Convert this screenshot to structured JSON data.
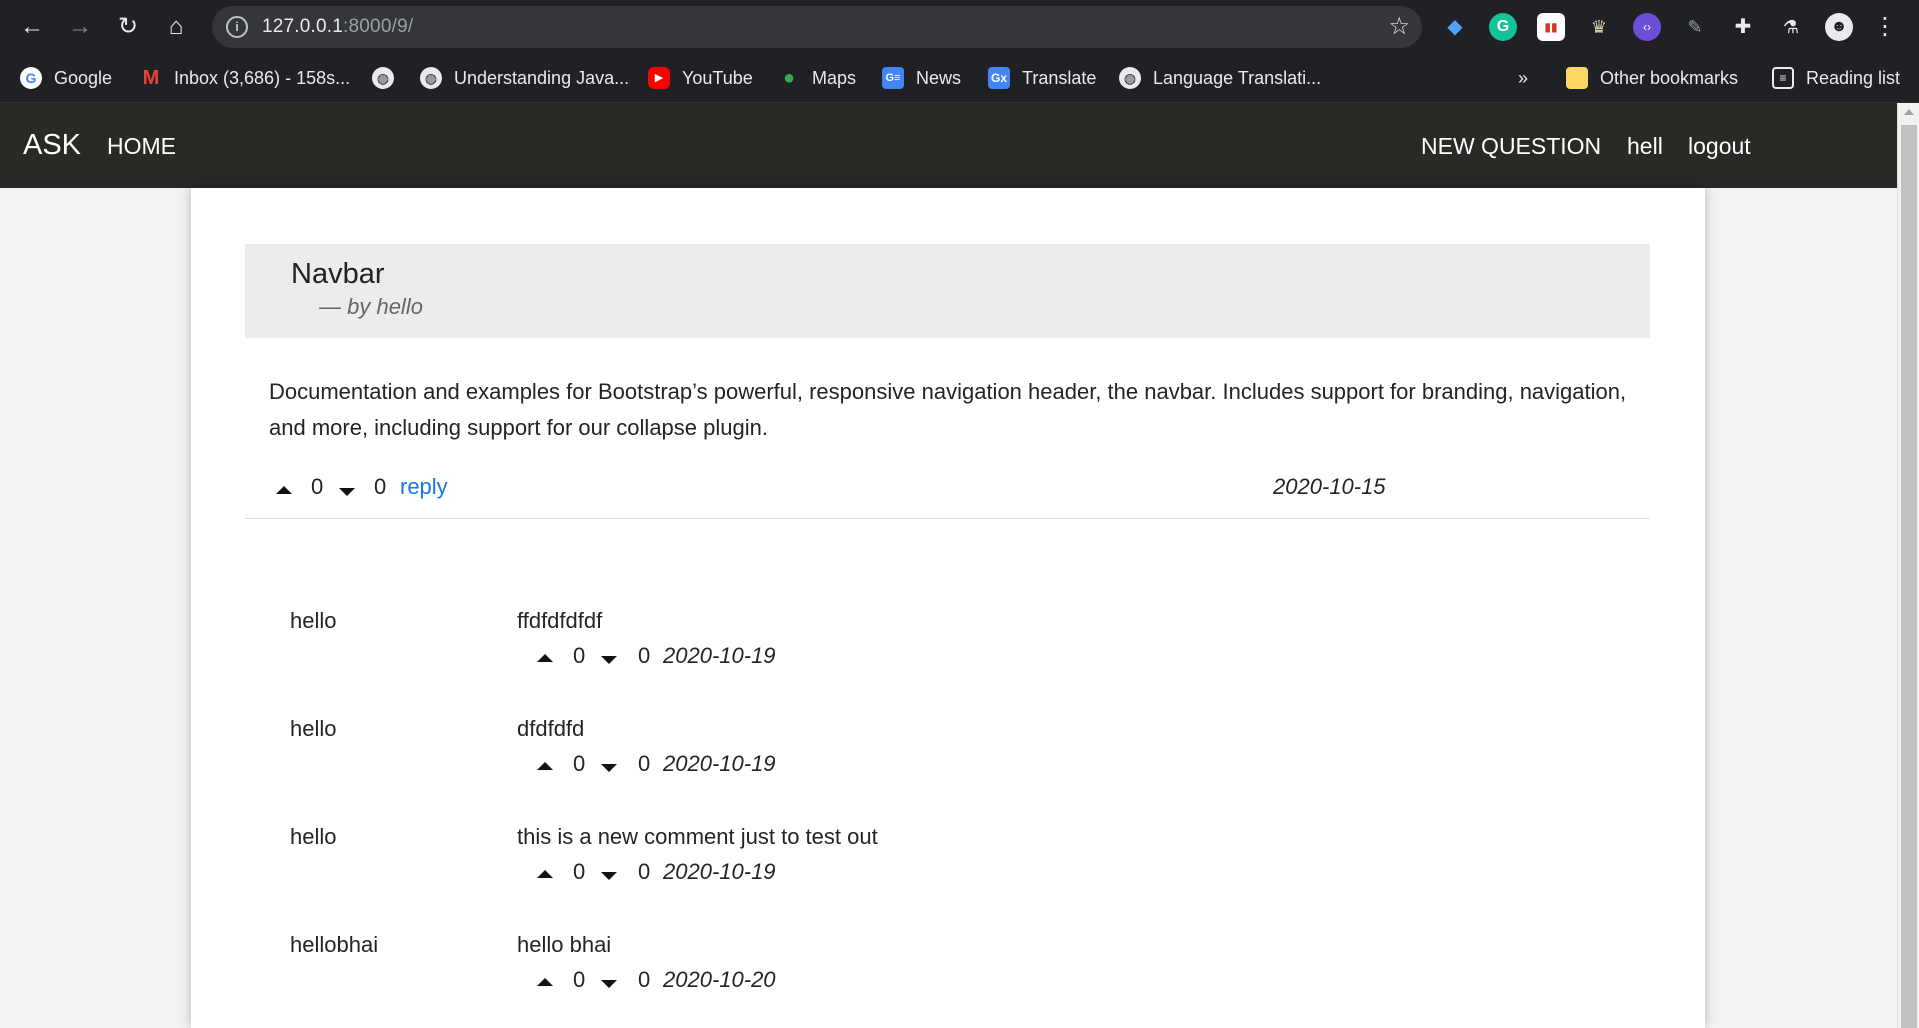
{
  "browser": {
    "url_host": "127.0.0.1",
    "url_path": ":8000/9/",
    "bookmarks": [
      {
        "label": "Google"
      },
      {
        "label": "Inbox (3,686) - 158s..."
      },
      {
        "label": "Understanding Java..."
      },
      {
        "label": "YouTube"
      },
      {
        "label": "Maps"
      },
      {
        "label": "News"
      },
      {
        "label": "Translate"
      },
      {
        "label": "Language Translati..."
      }
    ],
    "overflow": "»",
    "other_bookmarks": "Other bookmarks",
    "reading_list": "Reading list"
  },
  "nav": {
    "brand": "ASK",
    "home": "HOME",
    "new_question": "NEW QUESTION",
    "user": "hell",
    "logout": "logout"
  },
  "question": {
    "title": "Navbar",
    "byline": "—  by hello",
    "body": "Documentation and examples for Bootstrap’s powerful, responsive navigation header, the navbar. Includes support for branding, navigation, and more, including support for our collapse plugin.",
    "upvotes": "0",
    "downvotes": "0",
    "reply_label": "reply",
    "date": "2020-10-15"
  },
  "comments": [
    {
      "author": "hello",
      "text": "ffdfdfdfdf",
      "upvotes": "0",
      "downvotes": "0",
      "date": "2020-10-19"
    },
    {
      "author": "hello",
      "text": "dfdfdfd",
      "upvotes": "0",
      "downvotes": "0",
      "date": "2020-10-19"
    },
    {
      "author": "hello",
      "text": "this is a new comment just to test out",
      "upvotes": "0",
      "downvotes": "0",
      "date": "2020-10-19"
    },
    {
      "author": "hellobhai",
      "text": "hello bhai",
      "upvotes": "0",
      "downvotes": "0",
      "date": "2020-10-20"
    }
  ],
  "colors": {
    "navbar_bg": "#2a2926",
    "link_blue": "#1a73e8",
    "question_header_bg": "#ececec"
  }
}
